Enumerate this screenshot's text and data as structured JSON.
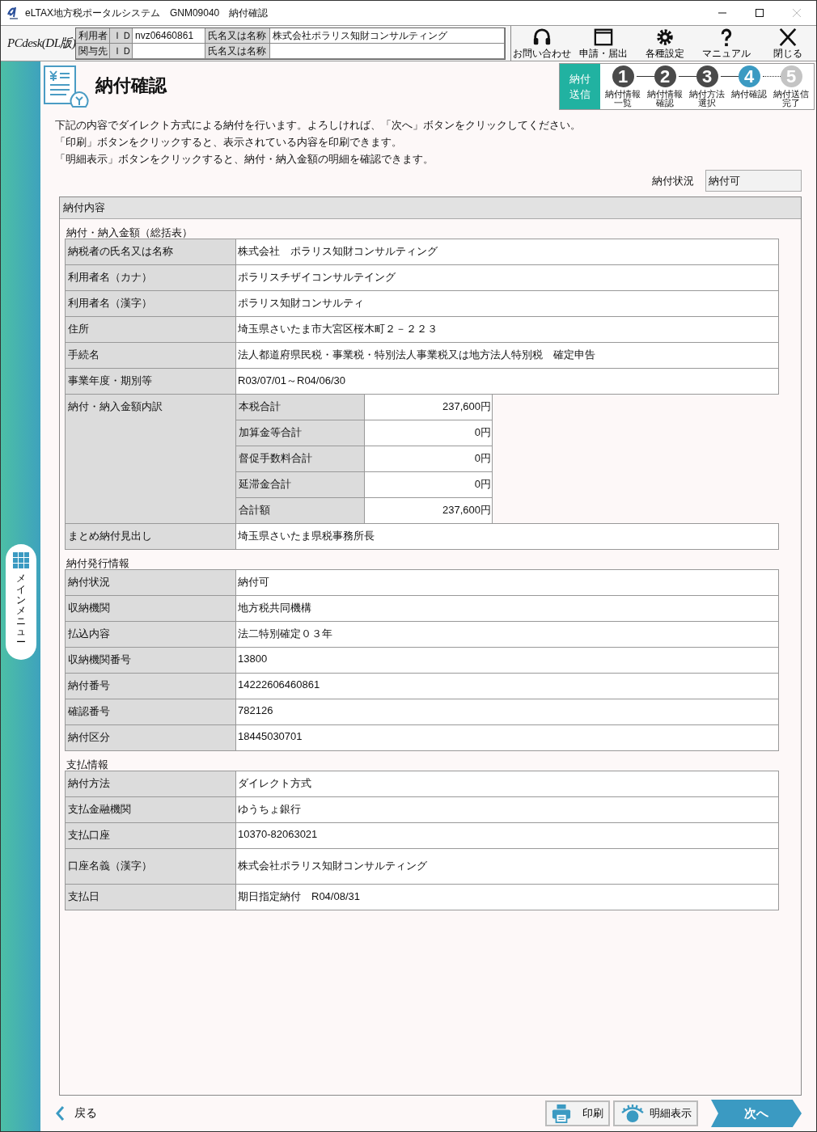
{
  "window": {
    "title": "eLTAX地方税ポータルシステム　GNM09040　納付確認"
  },
  "header": {
    "logo": "PCdesk(DL版)",
    "info_rows": [
      {
        "label": "利用者",
        "id_label": "ＩＤ",
        "id": "nvz06460861",
        "name_label": "氏名又は名称",
        "name": "株式会社ポラリス知財コンサルティング"
      },
      {
        "label": "関与先",
        "id_label": "ＩＤ",
        "name_label": "氏名又は名称"
      }
    ],
    "toolbar": [
      {
        "kind": "headset",
        "label": "お問い合わせ"
      },
      {
        "kind": "window",
        "label": "申請・届出"
      },
      {
        "kind": "gear",
        "label": "各種設定"
      },
      {
        "kind": "help",
        "label": "マニュアル"
      },
      {
        "kind": "close",
        "label": "閉じる"
      }
    ]
  },
  "side_menu": {
    "label": "メインメニュー"
  },
  "page": {
    "title": "納付確認",
    "steps": {
      "badge": [
        "納付",
        "送信"
      ],
      "items": [
        {
          "number": "1",
          "label": [
            "納付情報",
            "一覧"
          ],
          "completed": true,
          "selected": false
        },
        {
          "number": "2",
          "label": [
            "納付情報",
            "確認"
          ],
          "completed": true,
          "selected": false
        },
        {
          "number": "3",
          "label": [
            "納付方法",
            "選択"
          ],
          "completed": true,
          "selected": false
        },
        {
          "number": "4",
          "label": [
            "納付確認"
          ],
          "completed": false,
          "selected": true
        },
        {
          "number": "5",
          "label": [
            "納付送信",
            "完了"
          ],
          "completed": false,
          "selected": false
        }
      ]
    },
    "intro": [
      "下記の内容でダイレクト方式による納付を行います。よろしければ、「次へ」ボタンをクリックしてください。",
      "「印刷」ボタンをクリックすると、表示されている内容を印刷できます。",
      "「明細表示」ボタンをクリックすると、納付・納入金額の明細を確認できます。"
    ],
    "status": {
      "label": "納付状況",
      "value": "納付可"
    },
    "panel": {
      "title": "納付内容",
      "sections": [
        {
          "title": "納付・納入金額（総括表）",
          "rows": [
            {
              "kind": "text",
              "label": "納税者の氏名又は名称",
              "value": "株式会社　ポラリス知財コンサルティング"
            },
            {
              "kind": "text",
              "label": "利用者名（カナ）",
              "value": "ポラリスチザイコンサルテイング"
            },
            {
              "kind": "text",
              "label": "利用者名（漢字）",
              "value": "ポラリス知財コンサルティ"
            },
            {
              "kind": "text",
              "label": "住所",
              "value": "埼玉県さいたま市大宮区桜木町２－２２３"
            },
            {
              "kind": "text",
              "label": "手続名",
              "value": "法人都道府県民税・事業税・特別法人事業税又は地方法人特別税　確定申告"
            },
            {
              "kind": "text",
              "label": "事業年度・期別等",
              "value": "R03/07/01～R04/06/30"
            },
            {
              "kind": "breakdown",
              "label": "納付・納入金額内訳",
              "items": [
                {
                  "label": "本税合計",
                  "value": "237,600円"
                },
                {
                  "label": "加算金等合計",
                  "value": "0円"
                },
                {
                  "label": "督促手数料合計",
                  "value": "0円"
                },
                {
                  "label": "延滞金合計",
                  "value": "0円"
                },
                {
                  "label": "合計額",
                  "value": "237,600円"
                }
              ]
            },
            {
              "kind": "text",
              "label": "まとめ納付見出し",
              "value": "埼玉県さいたま県税事務所長"
            }
          ]
        },
        {
          "title": "納付発行情報",
          "rows": [
            {
              "kind": "text",
              "label": "納付状況",
              "value": "納付可"
            },
            {
              "kind": "text",
              "label": "収納機関",
              "value": "地方税共同機構"
            },
            {
              "kind": "text",
              "label": "払込内容",
              "value": "法二特別確定０３年"
            },
            {
              "kind": "text",
              "label": "収納機関番号",
              "value": "13800"
            },
            {
              "kind": "text",
              "label": "納付番号",
              "value": "14222606460861"
            },
            {
              "kind": "text",
              "label": "確認番号",
              "value": "782126"
            },
            {
              "kind": "text",
              "label": "納付区分",
              "value": "18445030701"
            }
          ]
        },
        {
          "title": "支払情報",
          "rows": [
            {
              "kind": "text",
              "label": "納付方法",
              "value": "ダイレクト方式"
            },
            {
              "kind": "text",
              "label": "支払金融機関",
              "value": "ゆうちょ銀行"
            },
            {
              "kind": "text",
              "label": "支払口座",
              "value": "10370-82063021"
            },
            {
              "kind": "tall",
              "label": "口座名義（漢字）",
              "value": "株式会社ポラリス知財コンサルティング"
            },
            {
              "kind": "text",
              "label": "支払日",
              "value": "期日指定納付　R04/08/31"
            }
          ]
        }
      ]
    }
  },
  "footer": {
    "back": "戻る",
    "print": "印刷",
    "detail": "明細表示",
    "next": "次へ"
  }
}
